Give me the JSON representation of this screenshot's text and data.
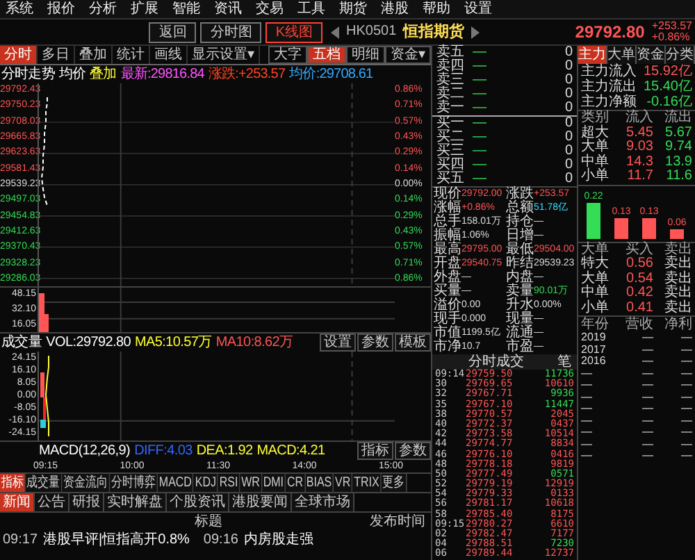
{
  "menu": [
    "系统",
    "报价",
    "分析",
    "扩展",
    "智能",
    "资讯",
    "交易",
    "工具",
    "期货",
    "港股",
    "帮助",
    "设置"
  ],
  "toolbar": [
    {
      "label": "返回",
      "selected": false
    },
    {
      "label": "分时图",
      "selected": false
    },
    {
      "label": "K线图",
      "selected": true
    }
  ],
  "quote": {
    "code": "HK0501",
    "name": "恒指期货",
    "price": "29792.80",
    "change": "+253.57",
    "pct": "+0.86%"
  },
  "chart": {
    "tabs": [
      {
        "label": "分时",
        "selected": true
      },
      {
        "label": "多日",
        "selected": false
      },
      {
        "label": "叠加",
        "selected": false
      },
      {
        "label": "统计",
        "selected": false
      },
      {
        "label": "画线",
        "selected": false
      },
      {
        "label": "显示设置▾",
        "selected": false
      }
    ],
    "side_tabs": [
      {
        "label": "大字",
        "selected": false
      },
      {
        "label": "五档",
        "selected": true
      },
      {
        "label": "明细",
        "selected": false
      },
      {
        "label": "资金▾",
        "selected": false
      }
    ],
    "info": [
      {
        "text": "分时走势",
        "color": "#ffffff"
      },
      {
        "text": "均价",
        "color": "#ffffff"
      },
      {
        "text": "叠加",
        "color": "#ffff33"
      },
      {
        "text": "最新:29816.84",
        "color": "#ff55ff"
      },
      {
        "text": "涨跌:+253.57",
        "color": "#ff4422"
      },
      {
        "text": "均价:29708.61",
        "color": "#33aaff"
      }
    ],
    "price_axis": [
      {
        "price": "29792.43",
        "pct": "0.86%",
        "kind": "up"
      },
      {
        "price": "29750.23",
        "pct": "0.71%",
        "kind": "up"
      },
      {
        "price": "29708.03",
        "pct": "0.57%",
        "kind": "up"
      },
      {
        "price": "29665.83",
        "pct": "0.43%",
        "kind": "up"
      },
      {
        "price": "29623.63",
        "pct": "0.29%",
        "kind": "up"
      },
      {
        "price": "29581.43",
        "pct": "0.14%",
        "kind": "up"
      },
      {
        "price": "29539.23",
        "pct": "0.00%",
        "kind": "flat"
      },
      {
        "price": "29497.03",
        "pct": "0.14%",
        "kind": "down"
      },
      {
        "price": "29454.83",
        "pct": "0.29%",
        "kind": "down"
      },
      {
        "price": "29412.63",
        "pct": "0.43%",
        "kind": "down"
      },
      {
        "price": "29370.43",
        "pct": "0.57%",
        "kind": "down"
      },
      {
        "price": "29328.23",
        "pct": "0.71%",
        "kind": "down"
      },
      {
        "price": "29286.03",
        "pct": "0.86%",
        "kind": "down"
      }
    ],
    "volume_info": [
      {
        "text": "成交量",
        "color": "#ffffff"
      },
      {
        "text": "VOL:29792.80",
        "color": "#ffffff"
      },
      {
        "text": "MA5:10.57万",
        "color": "#ffff33"
      },
      {
        "text": "MA10:8.62万",
        "color": "#ff5555"
      }
    ],
    "volume_buttons": [
      "设置",
      "参数",
      "模板"
    ],
    "volume_axis": [
      "48.15",
      "32.10",
      "16.05"
    ],
    "macd_info": [
      {
        "text": "MACD(12,26,9)",
        "color": "#ffffff"
      },
      {
        "text": "DIFF:4.03",
        "color": "#3366ff"
      },
      {
        "text": "DEA:1.92",
        "color": "#ffff33"
      },
      {
        "text": "MACD:4.21",
        "color": "#ffff33"
      }
    ],
    "macd_buttons": [
      "指标",
      "参数"
    ],
    "macd_axis": [
      "24.15",
      "16.10",
      "8.05",
      "0.00",
      "-8.05",
      "-16.10",
      "-24.15"
    ],
    "time_axis": [
      "09:15",
      "10:00",
      "11:30",
      "14:00",
      "15:00"
    ]
  },
  "indicator_tabs": [
    {
      "label": "指标",
      "selected": true
    },
    {
      "label": "成交量",
      "selected": false
    },
    {
      "label": "资金流向",
      "selected": false
    },
    {
      "label": "分时博弈",
      "selected": false
    },
    {
      "label": "MACD",
      "selected": false
    },
    {
      "label": "KDJ",
      "selected": false
    },
    {
      "label": "RSI",
      "selected": false
    },
    {
      "label": "WR",
      "selected": false
    },
    {
      "label": "DMI",
      "selected": false
    },
    {
      "label": "CR",
      "selected": false
    },
    {
      "label": "BIAS",
      "selected": false
    },
    {
      "label": "VR",
      "selected": false
    },
    {
      "label": "TRIX",
      "selected": false
    },
    {
      "label": "更多",
      "selected": false
    }
  ],
  "news_tabs": [
    {
      "label": "新闻",
      "selected": true
    },
    {
      "label": "公告",
      "selected": false
    },
    {
      "label": "研报",
      "selected": false
    },
    {
      "label": "实时解盘",
      "selected": false
    },
    {
      "label": "个股资讯",
      "selected": false
    },
    {
      "label": "港股要闻",
      "selected": false
    },
    {
      "label": "全球市场",
      "selected": false
    }
  ],
  "news_header": {
    "title": "标题",
    "time": "发布时间"
  },
  "news": [
    {
      "time": "09:17",
      "title": "港股早评|恒指高开0.8%"
    },
    {
      "time": "09:16",
      "title": "内房股走强"
    }
  ],
  "order_book": [
    {
      "label": "卖五",
      "price": "—",
      "volume": "0"
    },
    {
      "label": "卖四",
      "price": "—",
      "volume": "0"
    },
    {
      "label": "卖三",
      "price": "—",
      "volume": "0"
    },
    {
      "label": "卖二",
      "price": "—",
      "volume": "0"
    },
    {
      "label": "卖一",
      "price": "—",
      "volume": "0"
    },
    {
      "label": "买一",
      "price": "—",
      "volume": "0"
    },
    {
      "label": "买二",
      "price": "—",
      "volume": "0"
    },
    {
      "label": "买三",
      "price": "—",
      "volume": "0"
    },
    {
      "label": "买四",
      "price": "—",
      "volume": "0"
    },
    {
      "label": "买五",
      "price": "—",
      "volume": "0"
    }
  ],
  "stats": [
    [
      {
        "label": "现价",
        "value": "29792.00",
        "kind": "up"
      },
      {
        "label": "涨跌",
        "value": "+253.57",
        "kind": "up"
      }
    ],
    [
      {
        "label": "涨幅",
        "value": "+0.86%",
        "kind": "up"
      },
      {
        "label": "总额",
        "value": "51.78亿",
        "kind": "cyan"
      }
    ],
    [
      {
        "label": "总手",
        "value": "158.01万",
        "kind": "flat"
      },
      {
        "label": "持仓",
        "value": "—",
        "kind": "flat"
      }
    ],
    [
      {
        "label": "振幅",
        "value": "1.06%",
        "kind": "flat"
      },
      {
        "label": "日增",
        "value": "—",
        "kind": "flat"
      }
    ],
    [
      {
        "label": "最高",
        "value": "29795.00",
        "kind": "up"
      },
      {
        "label": "最低",
        "value": "29504.00",
        "kind": "up"
      }
    ],
    [
      {
        "label": "开盘",
        "value": "29540.75",
        "kind": "up"
      },
      {
        "label": "昨结",
        "value": "29539.23",
        "kind": "flat"
      }
    ],
    [
      {
        "label": "外盘",
        "value": "—",
        "kind": "flat"
      },
      {
        "label": "内盘",
        "value": "—",
        "kind": "flat"
      }
    ],
    [
      {
        "label": "买量",
        "value": "—",
        "kind": "flat"
      },
      {
        "label": "卖量",
        "value": "90.01万",
        "kind": "down"
      }
    ],
    [
      {
        "label": "溢价",
        "value": "0.00",
        "kind": "flat"
      },
      {
        "label": "升水",
        "value": "0.00%",
        "kind": "flat"
      }
    ],
    [
      {
        "label": "现手",
        "value": "0.000",
        "kind": "flat"
      },
      {
        "label": "现量",
        "value": "—",
        "kind": "flat"
      }
    ],
    [
      {
        "label": "市值",
        "value": "1199.5亿",
        "kind": "flat"
      },
      {
        "label": "流通",
        "value": "—",
        "kind": "flat"
      }
    ],
    [
      {
        "label": "市净",
        "value": "10.7",
        "kind": "flat"
      },
      {
        "label": "市盈",
        "value": "—",
        "kind": "flat"
      }
    ]
  ],
  "ticks_header": {
    "title": "分时成交",
    "unit": "笔"
  },
  "ticks": [
    {
      "time": "09:14",
      "price": "29759.50",
      "volume": "11736",
      "kind": "down"
    },
    {
      "time": "30",
      "price": "29769.65",
      "volume": "10610",
      "kind": "up"
    },
    {
      "time": "32",
      "price": "29767.71",
      "volume": "9936",
      "kind": "down"
    },
    {
      "time": "35",
      "price": "29767.10",
      "volume": "11447",
      "kind": "down"
    },
    {
      "time": "38",
      "price": "29770.57",
      "volume": "2045",
      "kind": "up"
    },
    {
      "time": "40",
      "price": "29772.37",
      "volume": "0437",
      "kind": "up"
    },
    {
      "time": "42",
      "price": "29773.58",
      "volume": "10514",
      "kind": "up"
    },
    {
      "time": "44",
      "price": "29774.77",
      "volume": "8834",
      "kind": "up"
    },
    {
      "time": "46",
      "price": "29776.10",
      "volume": "0416",
      "kind": "up"
    },
    {
      "time": "48",
      "price": "29778.18",
      "volume": "9819",
      "kind": "up"
    },
    {
      "time": "50",
      "price": "29777.49",
      "volume": "0571",
      "kind": "down"
    },
    {
      "time": "52",
      "price": "29779.19",
      "volume": "12919",
      "kind": "up"
    },
    {
      "time": "54",
      "price": "29779.33",
      "volume": "0133",
      "kind": "up"
    },
    {
      "time": "56",
      "price": "29781.17",
      "volume": "10618",
      "kind": "up"
    },
    {
      "time": "58",
      "price": "29785.40",
      "volume": "8175",
      "kind": "up"
    },
    {
      "time": "09:15",
      "price": "29780.27",
      "volume": "6610",
      "kind": "up"
    },
    {
      "time": "02",
      "price": "29782.47",
      "volume": "7177",
      "kind": "up"
    },
    {
      "time": "04",
      "price": "29788.51",
      "volume": "7230",
      "kind": "down"
    },
    {
      "time": "06",
      "price": "29789.44",
      "volume": "12737",
      "kind": "up"
    }
  ],
  "flow_tabs": [
    {
      "label": "主力",
      "selected": true
    },
    {
      "label": "大单",
      "selected": false
    },
    {
      "label": "资金",
      "selected": false
    },
    {
      "label": "分类",
      "selected": false
    }
  ],
  "flow_summary": [
    {
      "label": "主力流入",
      "value": "15.92亿",
      "kind": "up"
    },
    {
      "label": "主力流出",
      "value": "15.40亿",
      "kind": "down"
    },
    {
      "label": "主力净额",
      "value": "-0.16亿",
      "kind": "down"
    }
  ],
  "flow_table": {
    "columns": [
      "类别",
      "流入",
      "流出"
    ],
    "rows": [
      [
        "超大",
        "5.45",
        "5.67"
      ],
      [
        "大单",
        "9.03",
        "9.74"
      ],
      [
        "中单",
        "14.3",
        "13.9"
      ],
      [
        "小单",
        "11.7",
        "11.6"
      ]
    ]
  },
  "flow_chart": {
    "labels": [
      {
        "text": "0.22",
        "color": "#33dd55"
      },
      {
        "text": "0.13",
        "color": "#ff5555"
      },
      {
        "text": "0.13",
        "color": "#ff5555"
      },
      {
        "text": "0.06",
        "color": "#ff5555"
      }
    ]
  },
  "big_orders": {
    "columns": [
      "大单",
      "买入",
      "卖出"
    ],
    "rows": [
      [
        "特大",
        "0.56",
        "卖出"
      ],
      [
        "大单",
        "0.54",
        "卖出"
      ],
      [
        "中单",
        "0.42",
        "卖出"
      ],
      [
        "小单",
        "0.41",
        "卖出"
      ]
    ]
  },
  "finance": {
    "columns": [
      "年份",
      "营收",
      "净利"
    ],
    "rows": [
      [
        "2019",
        "—",
        "—"
      ],
      [
        "2017",
        "—",
        "—"
      ],
      [
        "2016",
        "—",
        "—"
      ],
      [
        "—",
        "—",
        "—"
      ],
      [
        "—",
        "—",
        "—"
      ],
      [
        "—",
        "—",
        "—"
      ],
      [
        "—",
        "—",
        "—"
      ],
      [
        "—",
        "—",
        "—"
      ],
      [
        "—",
        "—",
        "—"
      ],
      [
        "—",
        "—",
        "—"
      ],
      [
        "—",
        "—",
        "—"
      ]
    ]
  }
}
